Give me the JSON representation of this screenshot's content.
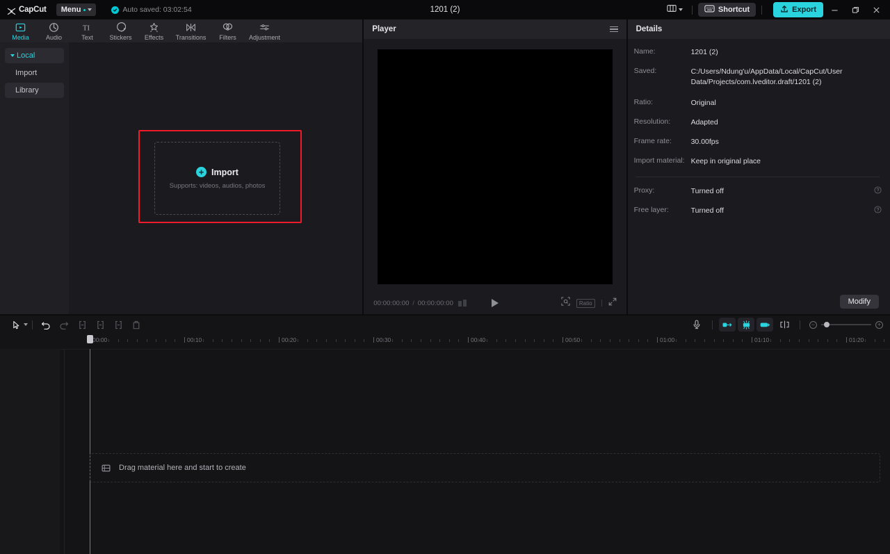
{
  "titlebar": {
    "brand": "CapCut",
    "menu_label": "Menu",
    "autosave_text": "Auto saved: 03:02:54",
    "project_title": "1201 (2)",
    "layout_icon": "layout-icon",
    "shortcut_label": "Shortcut",
    "export_label": "Export",
    "minimize_icon": "minimize-icon",
    "restore_icon": "restore-icon",
    "close_icon": "close-icon"
  },
  "tabs": [
    {
      "label": "Media",
      "icon": "media-icon",
      "active": true
    },
    {
      "label": "Audio",
      "icon": "audio-icon",
      "active": false
    },
    {
      "label": "Text",
      "icon": "text-icon",
      "active": false
    },
    {
      "label": "Stickers",
      "icon": "stickers-icon",
      "active": false
    },
    {
      "label": "Effects",
      "icon": "effects-icon",
      "active": false
    },
    {
      "label": "Transitions",
      "icon": "transitions-icon",
      "active": false
    },
    {
      "label": "Filters",
      "icon": "filters-icon",
      "active": false
    },
    {
      "label": "Adjustment",
      "icon": "adjustment-icon",
      "active": false
    }
  ],
  "sidebar": {
    "items": [
      {
        "label": "Local",
        "state": "active"
      },
      {
        "label": "Import",
        "state": "normal"
      },
      {
        "label": "Library",
        "state": "selected"
      }
    ]
  },
  "import_zone": {
    "title": "Import",
    "subtitle": "Supports: videos, audios, photos",
    "plus_glyph": "+",
    "highlight_color": "#ee1c2a"
  },
  "player": {
    "title": "Player",
    "menu_icon": "hamburger-icon",
    "current_time": "00:00:00:00",
    "total_time": "00:00:00:00",
    "time_separator": "/",
    "play_icon": "play-icon",
    "crop_icon": "crop-icon",
    "ratio_label": "Ratio",
    "fullscreen_icon": "fullscreen-icon"
  },
  "details": {
    "title": "Details",
    "rows": [
      {
        "label": "Name:",
        "value": "1201 (2)",
        "help": false
      },
      {
        "label": "Saved:",
        "value": "C:/Users/Ndung'u/AppData/Local/CapCut/User Data/Projects/com.lveditor.draft/1201 (2)",
        "help": false
      },
      {
        "label": "Ratio:",
        "value": "Original",
        "help": false
      },
      {
        "label": "Resolution:",
        "value": "Adapted",
        "help": false
      },
      {
        "label": "Frame rate:",
        "value": "30.00fps",
        "help": false
      },
      {
        "label": "Import material:",
        "value": "Keep in original place",
        "help": false
      }
    ],
    "rows2": [
      {
        "label": "Proxy:",
        "value": "Turned off",
        "help": true
      },
      {
        "label": "Free layer:",
        "value": "Turned off",
        "help": true
      }
    ],
    "modify_label": "Modify"
  },
  "timeline": {
    "tools": [
      {
        "name": "select-tool",
        "icon": "cursor-icon",
        "state": "bright"
      },
      {
        "name": "select-dropdown",
        "icon": "chevron-down-icon",
        "state": "normal"
      },
      {
        "name": "undo-button",
        "icon": "undo-icon",
        "state": "bright"
      },
      {
        "name": "redo-button",
        "icon": "redo-icon",
        "state": "dim"
      },
      {
        "name": "split-button",
        "icon": "split-icon",
        "state": "dim"
      },
      {
        "name": "trim-left-button",
        "icon": "trim-left-icon",
        "state": "dim"
      },
      {
        "name": "trim-right-button",
        "icon": "trim-right-icon",
        "state": "dim"
      },
      {
        "name": "delete-button",
        "icon": "trash-icon",
        "state": "dim"
      }
    ],
    "right_tools": [
      {
        "name": "record-voiceover-button",
        "icon": "microphone-icon",
        "accent": false
      },
      {
        "name": "auto-cut-button",
        "icon": "auto-cut-icon",
        "accent": true
      },
      {
        "name": "smart-edit-button",
        "icon": "smart-edit-icon",
        "accent": true
      },
      {
        "name": "link-clips-button",
        "icon": "link-clips-icon",
        "accent": true
      },
      {
        "name": "cut-marker-button",
        "icon": "cut-marker-icon",
        "accent": false
      }
    ],
    "zoom": {
      "minus": "−",
      "plus": "+"
    },
    "ruler_labels": [
      "00:00",
      "00:10",
      "00:20",
      "00:30",
      "00:40",
      "00:50",
      "01:00",
      "01:10",
      "01:20"
    ],
    "dropzone_text": "Drag material here and start to create",
    "dropzone_icon": "material-icon",
    "playhead_time": "00:00"
  }
}
